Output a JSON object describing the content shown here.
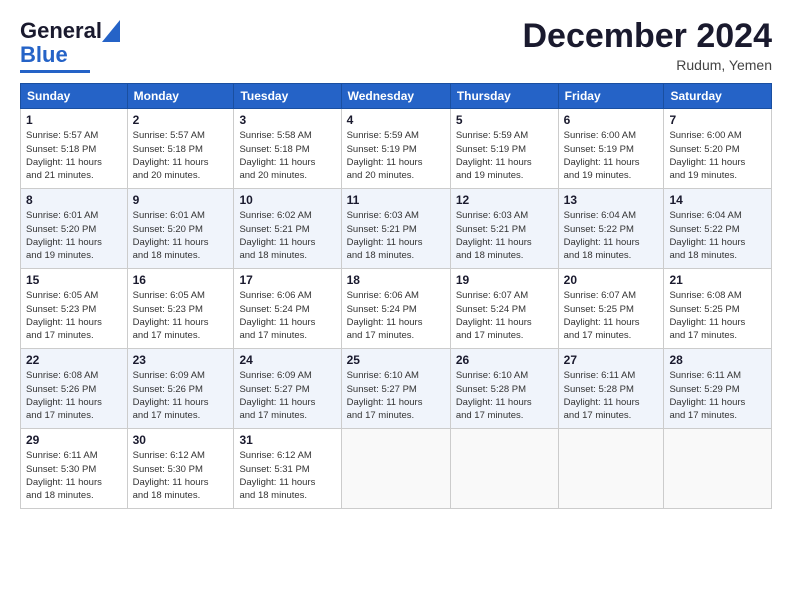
{
  "header": {
    "logo_line1": "General",
    "logo_line2": "Blue",
    "month_title": "December 2024",
    "location": "Rudum, Yemen"
  },
  "weekdays": [
    "Sunday",
    "Monday",
    "Tuesday",
    "Wednesday",
    "Thursday",
    "Friday",
    "Saturday"
  ],
  "weeks": [
    [
      {
        "day": "1",
        "lines": [
          "Sunrise: 5:57 AM",
          "Sunset: 5:18 PM",
          "Daylight: 11 hours",
          "and 21 minutes."
        ]
      },
      {
        "day": "2",
        "lines": [
          "Sunrise: 5:57 AM",
          "Sunset: 5:18 PM",
          "Daylight: 11 hours",
          "and 20 minutes."
        ]
      },
      {
        "day": "3",
        "lines": [
          "Sunrise: 5:58 AM",
          "Sunset: 5:18 PM",
          "Daylight: 11 hours",
          "and 20 minutes."
        ]
      },
      {
        "day": "4",
        "lines": [
          "Sunrise: 5:59 AM",
          "Sunset: 5:19 PM",
          "Daylight: 11 hours",
          "and 20 minutes."
        ]
      },
      {
        "day": "5",
        "lines": [
          "Sunrise: 5:59 AM",
          "Sunset: 5:19 PM",
          "Daylight: 11 hours",
          "and 19 minutes."
        ]
      },
      {
        "day": "6",
        "lines": [
          "Sunrise: 6:00 AM",
          "Sunset: 5:19 PM",
          "Daylight: 11 hours",
          "and 19 minutes."
        ]
      },
      {
        "day": "7",
        "lines": [
          "Sunrise: 6:00 AM",
          "Sunset: 5:20 PM",
          "Daylight: 11 hours",
          "and 19 minutes."
        ]
      }
    ],
    [
      {
        "day": "8",
        "lines": [
          "Sunrise: 6:01 AM",
          "Sunset: 5:20 PM",
          "Daylight: 11 hours",
          "and 19 minutes."
        ]
      },
      {
        "day": "9",
        "lines": [
          "Sunrise: 6:01 AM",
          "Sunset: 5:20 PM",
          "Daylight: 11 hours",
          "and 18 minutes."
        ]
      },
      {
        "day": "10",
        "lines": [
          "Sunrise: 6:02 AM",
          "Sunset: 5:21 PM",
          "Daylight: 11 hours",
          "and 18 minutes."
        ]
      },
      {
        "day": "11",
        "lines": [
          "Sunrise: 6:03 AM",
          "Sunset: 5:21 PM",
          "Daylight: 11 hours",
          "and 18 minutes."
        ]
      },
      {
        "day": "12",
        "lines": [
          "Sunrise: 6:03 AM",
          "Sunset: 5:21 PM",
          "Daylight: 11 hours",
          "and 18 minutes."
        ]
      },
      {
        "day": "13",
        "lines": [
          "Sunrise: 6:04 AM",
          "Sunset: 5:22 PM",
          "Daylight: 11 hours",
          "and 18 minutes."
        ]
      },
      {
        "day": "14",
        "lines": [
          "Sunrise: 6:04 AM",
          "Sunset: 5:22 PM",
          "Daylight: 11 hours",
          "and 18 minutes."
        ]
      }
    ],
    [
      {
        "day": "15",
        "lines": [
          "Sunrise: 6:05 AM",
          "Sunset: 5:23 PM",
          "Daylight: 11 hours",
          "and 17 minutes."
        ]
      },
      {
        "day": "16",
        "lines": [
          "Sunrise: 6:05 AM",
          "Sunset: 5:23 PM",
          "Daylight: 11 hours",
          "and 17 minutes."
        ]
      },
      {
        "day": "17",
        "lines": [
          "Sunrise: 6:06 AM",
          "Sunset: 5:24 PM",
          "Daylight: 11 hours",
          "and 17 minutes."
        ]
      },
      {
        "day": "18",
        "lines": [
          "Sunrise: 6:06 AM",
          "Sunset: 5:24 PM",
          "Daylight: 11 hours",
          "and 17 minutes."
        ]
      },
      {
        "day": "19",
        "lines": [
          "Sunrise: 6:07 AM",
          "Sunset: 5:24 PM",
          "Daylight: 11 hours",
          "and 17 minutes."
        ]
      },
      {
        "day": "20",
        "lines": [
          "Sunrise: 6:07 AM",
          "Sunset: 5:25 PM",
          "Daylight: 11 hours",
          "and 17 minutes."
        ]
      },
      {
        "day": "21",
        "lines": [
          "Sunrise: 6:08 AM",
          "Sunset: 5:25 PM",
          "Daylight: 11 hours",
          "and 17 minutes."
        ]
      }
    ],
    [
      {
        "day": "22",
        "lines": [
          "Sunrise: 6:08 AM",
          "Sunset: 5:26 PM",
          "Daylight: 11 hours",
          "and 17 minutes."
        ]
      },
      {
        "day": "23",
        "lines": [
          "Sunrise: 6:09 AM",
          "Sunset: 5:26 PM",
          "Daylight: 11 hours",
          "and 17 minutes."
        ]
      },
      {
        "day": "24",
        "lines": [
          "Sunrise: 6:09 AM",
          "Sunset: 5:27 PM",
          "Daylight: 11 hours",
          "and 17 minutes."
        ]
      },
      {
        "day": "25",
        "lines": [
          "Sunrise: 6:10 AM",
          "Sunset: 5:27 PM",
          "Daylight: 11 hours",
          "and 17 minutes."
        ]
      },
      {
        "day": "26",
        "lines": [
          "Sunrise: 6:10 AM",
          "Sunset: 5:28 PM",
          "Daylight: 11 hours",
          "and 17 minutes."
        ]
      },
      {
        "day": "27",
        "lines": [
          "Sunrise: 6:11 AM",
          "Sunset: 5:28 PM",
          "Daylight: 11 hours",
          "and 17 minutes."
        ]
      },
      {
        "day": "28",
        "lines": [
          "Sunrise: 6:11 AM",
          "Sunset: 5:29 PM",
          "Daylight: 11 hours",
          "and 17 minutes."
        ]
      }
    ],
    [
      {
        "day": "29",
        "lines": [
          "Sunrise: 6:11 AM",
          "Sunset: 5:30 PM",
          "Daylight: 11 hours",
          "and 18 minutes."
        ]
      },
      {
        "day": "30",
        "lines": [
          "Sunrise: 6:12 AM",
          "Sunset: 5:30 PM",
          "Daylight: 11 hours",
          "and 18 minutes."
        ]
      },
      {
        "day": "31",
        "lines": [
          "Sunrise: 6:12 AM",
          "Sunset: 5:31 PM",
          "Daylight: 11 hours",
          "and 18 minutes."
        ]
      },
      null,
      null,
      null,
      null
    ]
  ]
}
